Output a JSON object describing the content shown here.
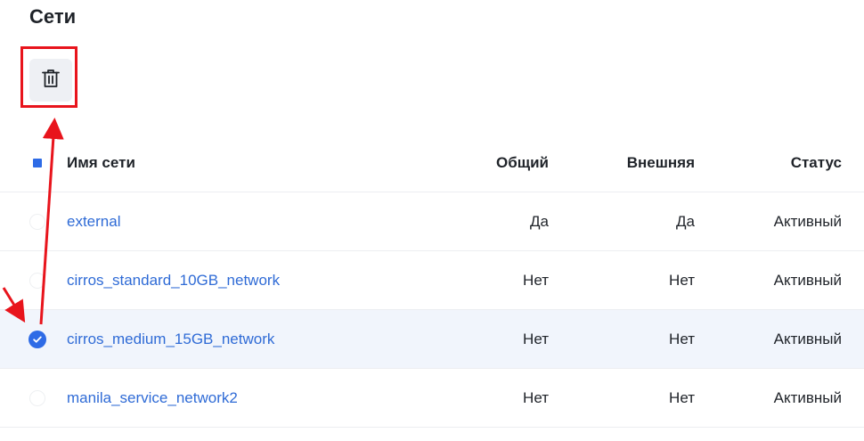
{
  "page": {
    "title": "Сети"
  },
  "toolbar": {
    "delete_icon": "trash-icon"
  },
  "table": {
    "columns": [
      "Имя сети",
      "Общий",
      "Внешняя",
      "Статус"
    ],
    "rows": [
      {
        "name": "external",
        "shared": "Да",
        "external": "Да",
        "status": "Активный",
        "selected": false
      },
      {
        "name": "cirros_standard_10GB_network",
        "shared": "Нет",
        "external": "Нет",
        "status": "Активный",
        "selected": false
      },
      {
        "name": "cirros_medium_15GB_network",
        "shared": "Нет",
        "external": "Нет",
        "status": "Активный",
        "selected": true
      },
      {
        "name": "manila_service_network2",
        "shared": "Нет",
        "external": "Нет",
        "status": "Активный",
        "selected": false
      }
    ]
  },
  "colors": {
    "accent": "#2e6be6",
    "link": "#2f6bd6",
    "annotation": "#e8141c",
    "selected_row": "#f1f5fc"
  }
}
